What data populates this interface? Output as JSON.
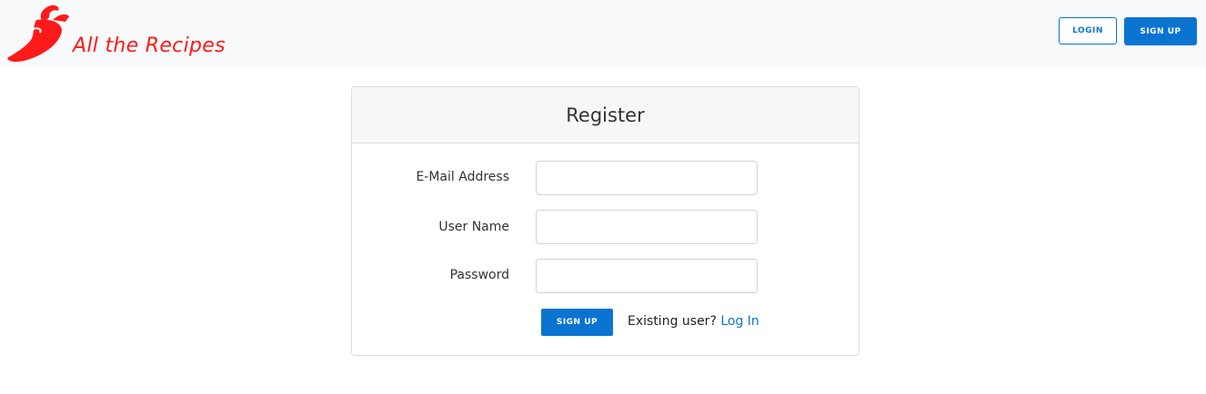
{
  "navbar": {
    "brand": "All the Recipes",
    "login_label": "LOGIN",
    "signup_label": "SIGN UP"
  },
  "form": {
    "title": "Register",
    "email_label": "E-Mail Address",
    "email_value": "",
    "username_label": "User Name",
    "username_value": "",
    "password_label": "Password",
    "password_value": "",
    "submit_label": "SIGN UP",
    "existing_text": "Existing user?",
    "login_link": "Log In"
  },
  "colors": {
    "brand": "#ff1a1a",
    "accent": "#0b74d1",
    "navbar_bg": "#f8f9fa",
    "card_header_bg": "#f7f7f7"
  },
  "icons": {
    "logo": "chili-pepper-icon"
  }
}
